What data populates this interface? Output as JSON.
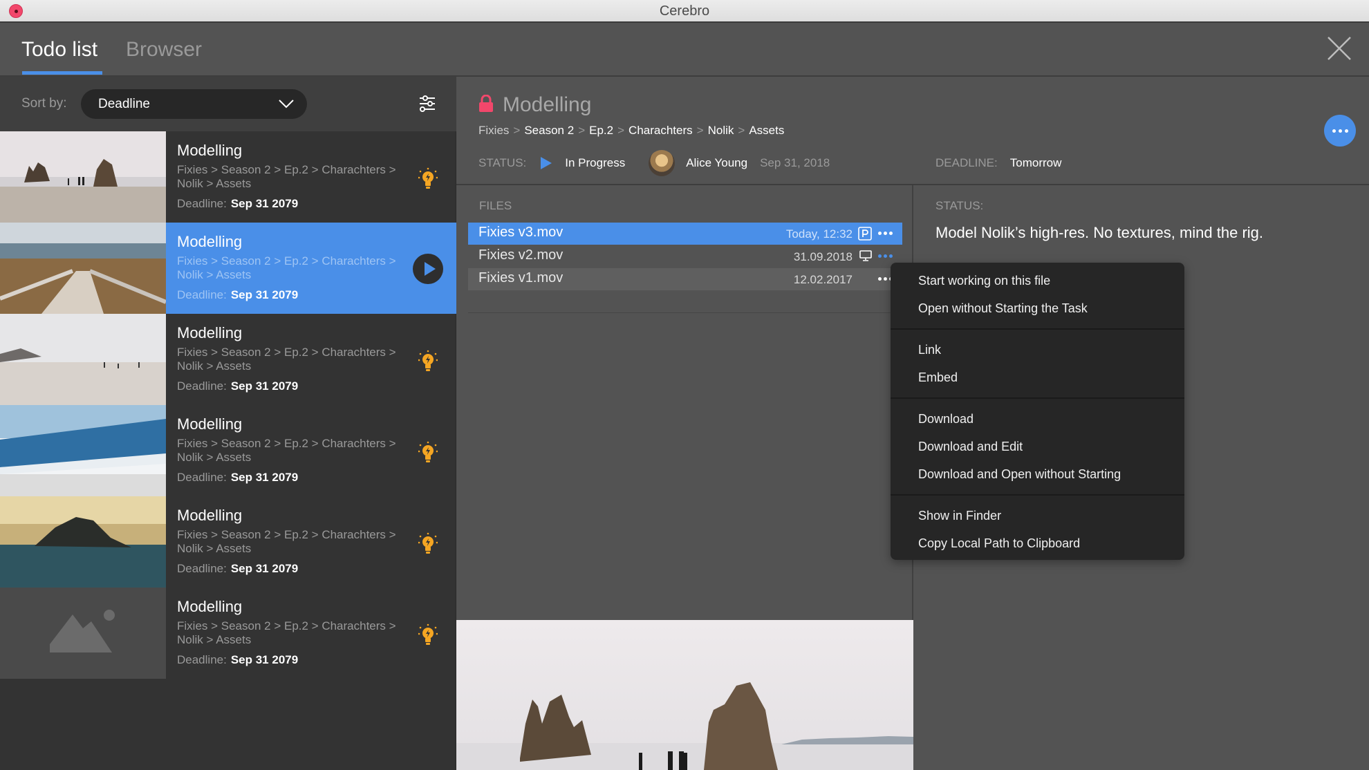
{
  "window": {
    "title": "Cerebro"
  },
  "tabs": [
    {
      "label": "Todo list",
      "active": true
    },
    {
      "label": "Browser",
      "active": false
    }
  ],
  "sort": {
    "label": "Sort by:",
    "value": "Deadline"
  },
  "colors": {
    "accent": "#4a8fe8",
    "lock": "#f2476b",
    "bulb": "#f5a623",
    "panel_dark": "#333333",
    "panel": "#535353",
    "menu": "#262626"
  },
  "tasks": [
    {
      "title": "Modelling",
      "path": "Fixies > Season 2 > Ep.2 > Charachters > Nolik > Assets",
      "deadline_label": "Deadline:",
      "deadline": "Sep 31 2079",
      "icon": "lightbulb-icon",
      "thumb": "rocks-beach"
    },
    {
      "title": "Modelling",
      "path": "Fixies > Season 2 > Ep.2 > Charachters > Nolik > Assets",
      "deadline_label": "Deadline:",
      "deadline": "Sep 31 2079",
      "icon": "play-icon",
      "thumb": "boardwalk",
      "selected": true
    },
    {
      "title": "Modelling",
      "path": "Fixies > Season 2 > Ep.2 > Charachters > Nolik > Assets",
      "deadline_label": "Deadline:",
      "deadline": "Sep 31 2079",
      "icon": "lightbulb-icon",
      "thumb": "foggy-beach"
    },
    {
      "title": "Modelling",
      "path": "Fixies > Season 2 > Ep.2 > Charachters > Nolik > Assets",
      "deadline_label": "Deadline:",
      "deadline": "Sep 31 2079",
      "icon": "lightbulb-icon",
      "thumb": "blue-shore"
    },
    {
      "title": "Modelling",
      "path": "Fixies > Season 2 > Ep.2 > Charachters > Nolik > Assets",
      "deadline_label": "Deadline:",
      "deadline": "Sep 31 2079",
      "icon": "lightbulb-icon",
      "thumb": "island-sunset"
    },
    {
      "title": "Modelling",
      "path": "Fixies > Season 2 > Ep.2 > Charachters > Nolik > Assets",
      "deadline_label": "Deadline:",
      "deadline": "Sep 31 2079",
      "icon": "lightbulb-icon",
      "thumb": "placeholder"
    }
  ],
  "detail": {
    "title": "Modelling",
    "breadcrumb": [
      "Fixies",
      "Season 2",
      "Ep.2",
      "Charachters",
      "Nolik",
      "Assets"
    ],
    "status_label": "STATUS:",
    "status_value": "In Progress",
    "user_name": "Alice Young",
    "user_date": "Sep 31, 2018",
    "deadline_label": "DEADLINE:",
    "deadline_value": "Tomorrow"
  },
  "files": {
    "label": "FILES",
    "rows": [
      {
        "name": "Fixies v3.mov",
        "date": "Today, 12:32",
        "icon": "publish-icon",
        "selected": true
      },
      {
        "name": "Fixies v2.mov",
        "date": "31.09.2018",
        "icon": "monitor-icon"
      },
      {
        "name": "Fixies v1.mov",
        "date": "12.02.2017",
        "icon": ""
      }
    ]
  },
  "status_pane": {
    "label": "STATUS:",
    "text": "Model Nolik’s high-res. No textures, mind the rig."
  },
  "context_menu": {
    "groups": [
      [
        "Start working on this file",
        "Open without Starting the Task"
      ],
      [
        "Link",
        "Embed"
      ],
      [
        "Download",
        "Download and Edit",
        "Download and Open without Starting"
      ],
      [
        "Show in Finder",
        "Copy Local Path to Clipboard"
      ]
    ]
  }
}
